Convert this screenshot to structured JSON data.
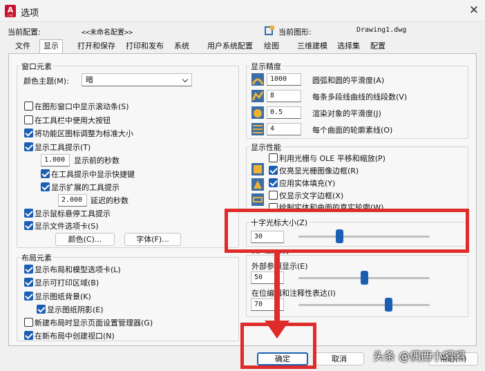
{
  "window": {
    "title": "选项",
    "app_icon_letter": "A",
    "app_icon_caption": "CAD"
  },
  "header": {
    "current_profile_label": "当前配置:",
    "current_profile_value": "<<未命名配置>>",
    "current_drawing_label": "当前图形:",
    "current_drawing_value": "Drawing1.dwg"
  },
  "tabs": [
    "文件",
    "显示",
    "打开和保存",
    "打印和发布",
    "系统",
    "用户系统配置",
    "绘图",
    "三维建模",
    "选择集",
    "配置"
  ],
  "active_tab": "显示",
  "window_elements": {
    "title": "窗口元素",
    "color_theme_label": "颜色主题(M):",
    "color_theme_value": "暗",
    "checkboxes": [
      {
        "label": "在图形窗口中显示滚动条(S)",
        "checked": false
      },
      {
        "label": "在工具栏中使用大按钮",
        "checked": false
      },
      {
        "label": "将功能区图标调整为标准大小",
        "checked": true
      },
      {
        "label": "显示工具提示(T)",
        "checked": true
      }
    ],
    "tooltip_delay_value": "1.000",
    "tooltip_delay_label": "显示前的秒数",
    "sub_checkboxes": [
      {
        "label": "在工具提示中显示快捷键",
        "checked": true
      },
      {
        "label": "显示扩展的工具提示",
        "checked": true
      }
    ],
    "extended_delay_value": "2.000",
    "extended_delay_label": "延迟的秒数",
    "checkboxes2": [
      {
        "label": "显示鼠标悬停工具提示",
        "checked": true
      },
      {
        "label": "显示文件选项卡(S)",
        "checked": true
      }
    ],
    "colors_button": "颜色(C)...",
    "fonts_button": "字体(F)..."
  },
  "layout_elements": {
    "title": "布局元素",
    "checkboxes": [
      {
        "label": "显示布局和模型选项卡(L)",
        "checked": true
      },
      {
        "label": "显示可打印区域(B)",
        "checked": true
      },
      {
        "label": "显示图纸背景(K)",
        "checked": true
      },
      {
        "label": "显示图纸阴影(E)",
        "checked": true
      },
      {
        "label": "新建布局时显示页面设置管理器(G)",
        "checked": false
      },
      {
        "label": "在新布局中创建视口(N)",
        "checked": true
      }
    ]
  },
  "display_resolution": {
    "title": "显示精度",
    "rows": [
      {
        "value": "1000",
        "label": "圆弧和圆的平滑度(A)"
      },
      {
        "value": "8",
        "label": "每条多段线曲线的线段数(V)"
      },
      {
        "value": "0.5",
        "label": "渲染对象的平滑度(J)"
      },
      {
        "value": "4",
        "label": "每个曲面的轮廓素线(O)"
      }
    ]
  },
  "display_performance": {
    "title": "显示性能",
    "checkboxes": [
      {
        "label": "利用光栅与 OLE 平移和缩放(P)",
        "checked": false
      },
      {
        "label": "仅亮显光栅图像边框(R)",
        "checked": true
      },
      {
        "label": "应用实体填充(Y)",
        "checked": true
      },
      {
        "label": "仅显示文字边框(X)",
        "checked": false
      },
      {
        "label": "绘制实体和曲面的真实轮廓(W)",
        "checked": false
      }
    ]
  },
  "crosshair": {
    "title": "十字光标大小(Z)",
    "value": "30",
    "level_percent": 30
  },
  "fade_control": {
    "title": "淡入度控制",
    "xref_label": "外部参照显示(E)",
    "xref_value": "50",
    "xref_percent": 50,
    "inplace_label": "在位编辑和注释性表达(I)",
    "inplace_value": "70",
    "inplace_percent": 70
  },
  "footer": {
    "ok": "确定",
    "cancel": "取消",
    "help": "帮助(H)"
  },
  "watermark": "头条 @偶西小嘚嘚",
  "colors": {
    "accent": "#1a5fb4",
    "annotation_red": "#e02b2b"
  }
}
